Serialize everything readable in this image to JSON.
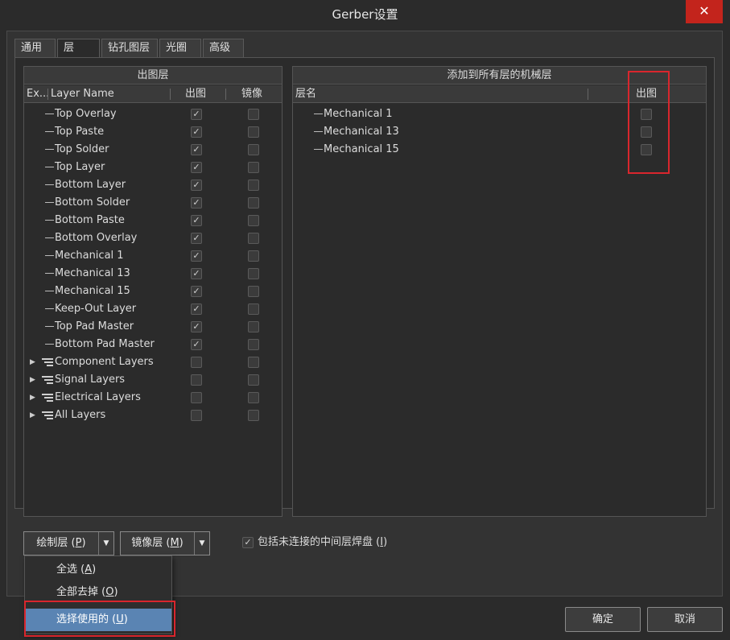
{
  "window": {
    "title": "Gerber设置",
    "close_glyph": "✕"
  },
  "tabs": [
    {
      "label": "通用"
    },
    {
      "label": "层"
    },
    {
      "label": "钻孔图层"
    },
    {
      "label": "光圈"
    },
    {
      "label": "高级"
    }
  ],
  "plot_layers": {
    "header": "出图层",
    "columns": {
      "expand": "Ex...",
      "name": "Layer Name",
      "plot": "出图",
      "mirror": "镜像"
    },
    "rows": [
      {
        "name": "Top Overlay",
        "plot": true,
        "mirror": false,
        "group": false
      },
      {
        "name": "Top Paste",
        "plot": true,
        "mirror": false,
        "group": false
      },
      {
        "name": "Top Solder",
        "plot": true,
        "mirror": false,
        "group": false
      },
      {
        "name": "Top Layer",
        "plot": true,
        "mirror": false,
        "group": false
      },
      {
        "name": "Bottom Layer",
        "plot": true,
        "mirror": false,
        "group": false
      },
      {
        "name": "Bottom Solder",
        "plot": true,
        "mirror": false,
        "group": false
      },
      {
        "name": "Bottom Paste",
        "plot": true,
        "mirror": false,
        "group": false
      },
      {
        "name": "Bottom Overlay",
        "plot": true,
        "mirror": false,
        "group": false
      },
      {
        "name": "Mechanical 1",
        "plot": true,
        "mirror": false,
        "group": false
      },
      {
        "name": "Mechanical 13",
        "plot": true,
        "mirror": false,
        "group": false
      },
      {
        "name": "Mechanical 15",
        "plot": true,
        "mirror": false,
        "group": false
      },
      {
        "name": "Keep-Out Layer",
        "plot": true,
        "mirror": false,
        "group": false
      },
      {
        "name": "Top Pad Master",
        "plot": true,
        "mirror": false,
        "group": false
      },
      {
        "name": "Bottom Pad Master",
        "plot": true,
        "mirror": false,
        "group": false
      },
      {
        "name": "Component Layers",
        "plot": false,
        "mirror": false,
        "group": true
      },
      {
        "name": "Signal Layers",
        "plot": false,
        "mirror": false,
        "group": true
      },
      {
        "name": "Electrical Layers",
        "plot": false,
        "mirror": false,
        "group": true
      },
      {
        "name": "All Layers",
        "plot": false,
        "mirror": false,
        "group": true
      }
    ]
  },
  "mech_layers": {
    "header": "添加到所有层的机械层",
    "columns": {
      "name": "层名",
      "plot": "出图"
    },
    "rows": [
      {
        "name": "Mechanical 1",
        "plot": false
      },
      {
        "name": "Mechanical 13",
        "plot": false
      },
      {
        "name": "Mechanical 15",
        "plot": false
      }
    ]
  },
  "bottom": {
    "plot_layers_btn": {
      "text": "绘制层 (",
      "key": "P",
      "tail": ")"
    },
    "mirror_layers_btn": {
      "text": "镜像层 (",
      "key": "M",
      "tail": ")"
    },
    "include_unconnected": {
      "text": "包括未连接的中间层焊盘 (",
      "key": "I",
      "tail": ")",
      "checked": true
    },
    "ok": "确定",
    "cancel": "取消"
  },
  "dropdown_menu": [
    {
      "text": "全选 (",
      "key": "A",
      "tail": ")",
      "selected": false
    },
    {
      "text": "全部去掉 (",
      "key": "O",
      "tail": ")",
      "selected": false
    },
    {
      "text": "选择使用的 (",
      "key": "U",
      "tail": ")",
      "selected": true
    }
  ],
  "colors": {
    "highlight": "#d9262d",
    "selected_menu": "#5a84b3",
    "close": "#c3241c"
  }
}
